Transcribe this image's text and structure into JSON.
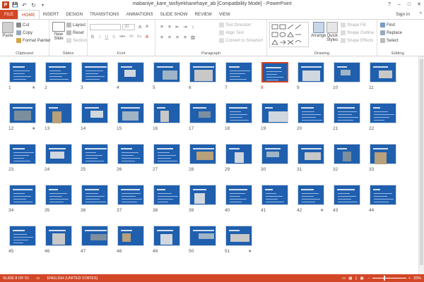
{
  "window": {
    "title": "mabaniye_kare_tasfiyekhanehaye_ab [Compatibility Mode] - PowerPoint",
    "app_icon": "P",
    "sign_in": "Sign in",
    "help": "?",
    "minimize": "–",
    "maximize": "□",
    "close": "✕",
    "collapse": "^"
  },
  "qat": {
    "save": "💾",
    "undo": "↶",
    "redo": "↻",
    "customize": "▾"
  },
  "tabs": [
    "FILE",
    "HOME",
    "INSERT",
    "DESIGN",
    "TRANSITIONS",
    "ANIMATIONS",
    "SLIDE SHOW",
    "REVIEW",
    "VIEW"
  ],
  "active_tab": "HOME",
  "ribbon": {
    "clipboard": {
      "label": "Clipboard",
      "paste": "Paste",
      "cut": "Cut",
      "copy": "Copy",
      "format_painter": "Format Painter"
    },
    "slides": {
      "label": "Slides",
      "new_slide": "New",
      "new_slide2": "Slide",
      "layout": "Layout",
      "reset": "Reset",
      "section": "Section"
    },
    "font": {
      "label": "Font",
      "size": "30",
      "B": "B",
      "I": "I",
      "U": "U",
      "S": "S",
      "abc": "abc",
      "AV": "AV",
      "Aa": "Aa",
      "A": "A"
    },
    "paragraph": {
      "label": "Paragraph",
      "text_direction": "Text Direction",
      "align_text": "Align Text",
      "smartart": "Convert to SmartArt"
    },
    "drawing": {
      "label": "Drawing",
      "arrange": "Arrange",
      "quick_styles": "Quick",
      "quick_styles2": "Styles",
      "shape_fill": "Shape Fill",
      "shape_outline": "Shape Outline",
      "shape_effects": "Shape Effects"
    },
    "editing": {
      "label": "Editing",
      "find": "Find",
      "replace": "Replace",
      "select": "Select"
    }
  },
  "slides": {
    "selected": 8,
    "total": 51,
    "starred": [
      1,
      12,
      42,
      51
    ],
    "numbers": [
      "1",
      "2",
      "3",
      "4",
      "5",
      "6",
      "7",
      "8",
      "9",
      "10",
      "11",
      "12",
      "13",
      "14",
      "15",
      "16",
      "17",
      "18",
      "19",
      "20",
      "21",
      "22",
      "23",
      "24",
      "25",
      "26",
      "27",
      "28",
      "29",
      "30",
      "31",
      "32",
      "33",
      "34",
      "35",
      "36",
      "37",
      "38",
      "39",
      "40",
      "41",
      "42",
      "43",
      "44",
      "45",
      "46",
      "47",
      "48",
      "49",
      "50",
      "51"
    ],
    "star_glyph": "★",
    "image_slides": [
      4,
      5,
      6,
      9,
      10,
      11,
      12,
      13,
      14,
      15,
      16,
      17,
      19,
      24,
      28,
      29,
      30,
      31,
      32,
      33,
      39,
      46,
      47,
      48,
      49,
      50,
      51
    ]
  },
  "status": {
    "slide_info": "SLIDE 8 OF 51",
    "language": "ENGLISH (UNITED STATES)",
    "zoom": "33%",
    "zoom_fraction": 0.33,
    "minus": "–",
    "plus": "+"
  },
  "colors": {
    "accent": "#d24726",
    "slide_bg": "#1f5fae",
    "status_bg": "#d24726"
  }
}
